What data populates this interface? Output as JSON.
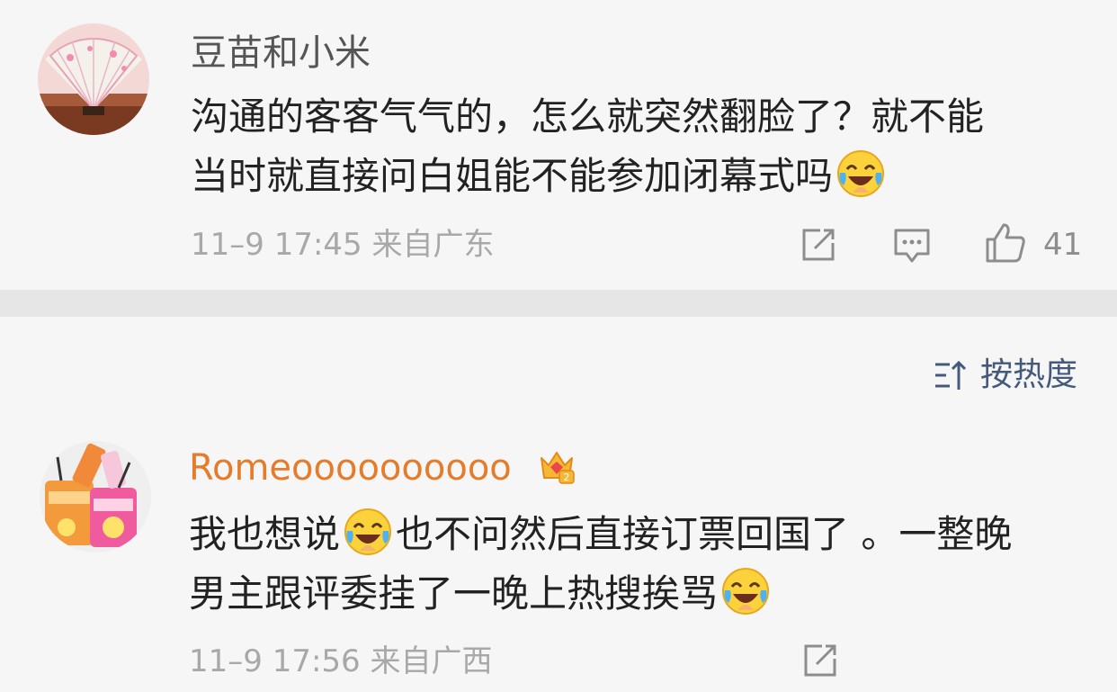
{
  "comments": [
    {
      "username": "豆苗和小米",
      "text_line1": "沟通的客客气气的，怎么就突然翻脸了？就不能",
      "text_line2": "当时就直接问白姐能不能参加闭幕式吗",
      "emoji": "laugh-cry-emoji",
      "meta": "11–9 17:45 来自广东",
      "like_count": "41",
      "username_color": "#555555"
    },
    {
      "username": "Romeoooooooooo",
      "text_line1_a": "我也想说",
      "text_line1_b": "也不问然后直接订票回国了 。一整晚",
      "text_line2": "男主跟评委挂了一晚上热搜挨骂",
      "emoji": "laugh-cry-emoji",
      "badge": "crown-badge",
      "meta": "11–9 17:56 来自广西",
      "username_color": "#e57c2b"
    }
  ],
  "sort": {
    "label": "按热度",
    "icon": "sort-icon"
  },
  "colors": {
    "background": "#f6f6f6",
    "divider": "#e6e6e6",
    "link": "#45597b",
    "meta": "#a8a8a8"
  }
}
